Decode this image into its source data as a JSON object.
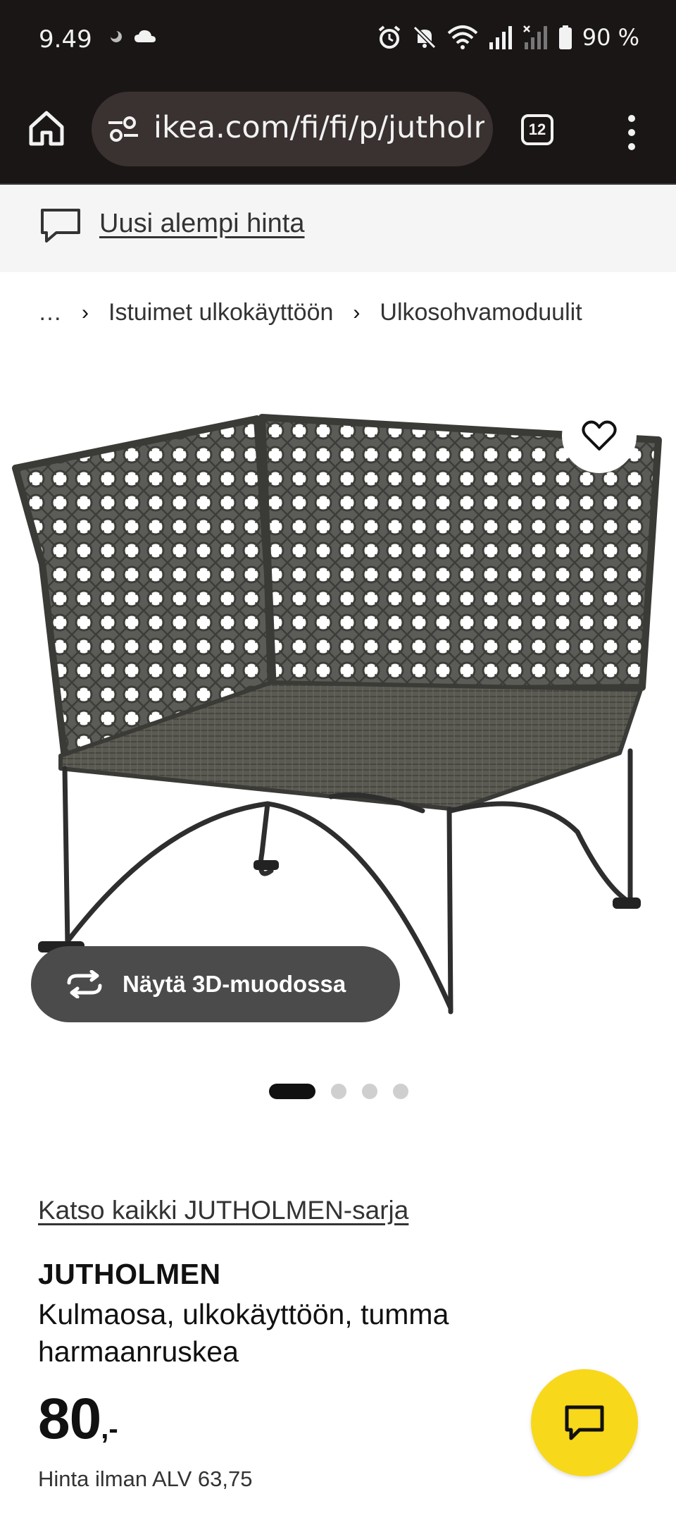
{
  "status_bar": {
    "time": "9.49",
    "battery": "90 %",
    "icons": [
      "moon-icon",
      "cloud-icon",
      "alarm-icon",
      "mute-icon",
      "wifi-icon",
      "signal-icon",
      "signal-no-service-icon",
      "battery-icon"
    ]
  },
  "browser": {
    "url": "ikea.com/fi/fi/p/jutholmen",
    "tab_count": "12",
    "icons": [
      "home-icon",
      "site-settings-icon",
      "tabs-icon",
      "more-menu-icon"
    ]
  },
  "banner": {
    "text": "Uusi alempi hinta",
    "icon": "chat-bubble-icon"
  },
  "breadcrumb": {
    "items": [
      "…",
      "Istuimet ulkokäyttöön",
      "Ulkosohvamoduulit"
    ]
  },
  "gallery": {
    "button_3d": "Näytä 3D-muodossa",
    "slide_count": 4,
    "active_slide": 1
  },
  "product": {
    "series_link": "Katso kaikki JUTHOLMEN-sarja",
    "name": "JUTHOLMEN",
    "description": "Kulmaosa, ulkokäyttöön, tumma harmaanruskea",
    "price": "80",
    "price_suffix": ",-",
    "vat_text": "Hinta ilman ALV 63,75"
  },
  "colors": {
    "chat_fab": "#f8d81a",
    "top_bar": "#1a1616",
    "button_3d": "#4b4b4b"
  }
}
